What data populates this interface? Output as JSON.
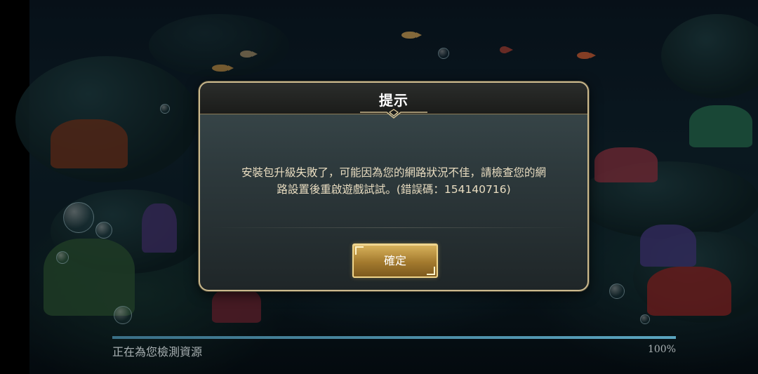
{
  "dialog": {
    "title": "提示",
    "message_line1": "安裝包升級失敗了，可能因為您的網路狀況不佳，請檢查您的網",
    "message_line2": "路設置後重啟遊戲試試。(錯誤碼：154140716)",
    "confirm_label": "確定"
  },
  "loading": {
    "status_text": "正在為您檢測資源",
    "percent_text": "100%",
    "progress": 1.0
  },
  "colors": {
    "dialog_border": "#cbb98d",
    "button_gold": "#d9b35c",
    "message_text": "#e8dcc0",
    "progress_fill": "#5aa4bf"
  },
  "icons": [
    "title-ornament-icon"
  ]
}
